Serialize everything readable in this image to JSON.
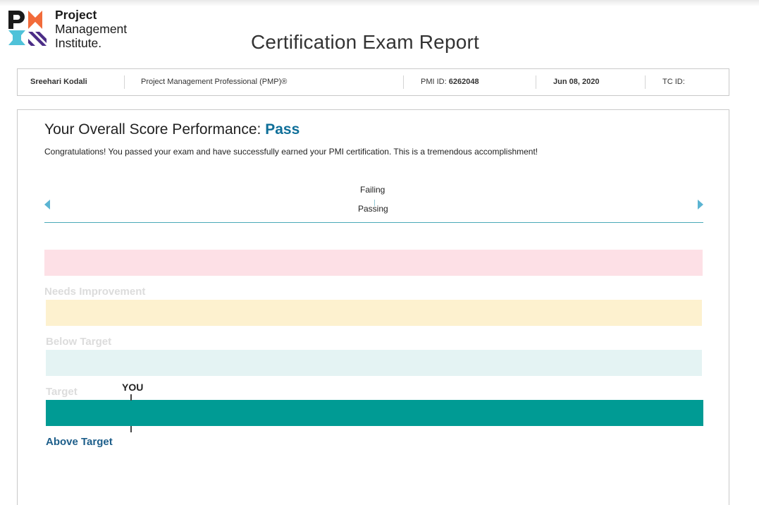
{
  "org": {
    "line1": "Project",
    "line2": "Management",
    "line3": "Institute.",
    "logo_colors": {
      "dark": "#1b1b1b",
      "orange": "#f26b3a",
      "blue": "#4fc2d9",
      "purple": "#4b2c86"
    }
  },
  "page": {
    "title": "Certification Exam Report"
  },
  "candidate": {
    "name": "Sreehari Kodali",
    "exam": "Project Management Professional (PMP)®",
    "pmi_id_label": "PMI ID:",
    "pmi_id": "6262048",
    "date": "Jun 08, 2020",
    "tc_id_label": "TC ID:"
  },
  "overall": {
    "heading": "Your Overall Score Performance:",
    "result": "Pass",
    "message": "Congratulations! You passed your exam and have successfully earned your PMI certification. This is a tremendous accomplishment!"
  },
  "scale": {
    "failing_label": "Failing",
    "passing_label": "Passing",
    "arrow_color": "#5bb4d2"
  },
  "performance": {
    "bands": [
      {
        "label": "Needs Improvement",
        "color": "#fde0e6",
        "active": false
      },
      {
        "label": "Below Target",
        "color": "#fdf1cf",
        "active": false
      },
      {
        "label": "Target",
        "color": "#e4f3f3",
        "active": false
      },
      {
        "label": "Above Target",
        "color": "#009b94",
        "active": true
      }
    ],
    "you_label": "YOU",
    "you_band": "Above Target"
  }
}
